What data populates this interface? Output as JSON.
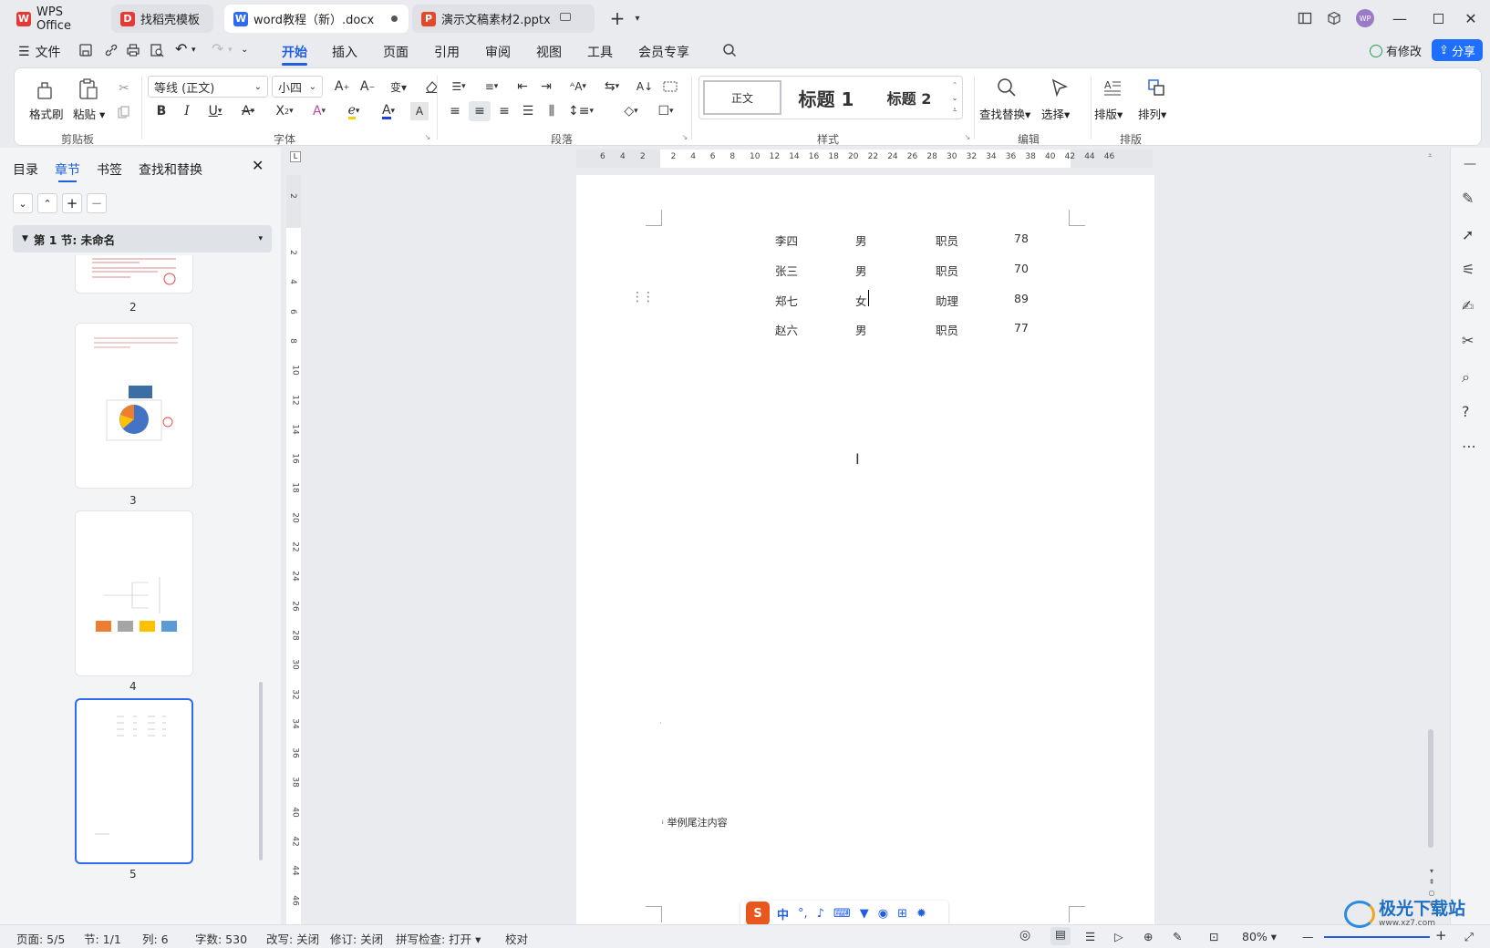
{
  "tabs": [
    {
      "label": "WPS Office",
      "icon": "wps-logo-icon",
      "color": "#e53935"
    },
    {
      "label": "找稻壳模板",
      "icon": "docer-icon",
      "color": "#e53935"
    },
    {
      "label": "word教程（新）.docx",
      "icon": "word-doc-icon",
      "color": "#2f6bf0"
    },
    {
      "label": "演示文稿素材2.pptx",
      "icon": "ppt-icon",
      "color": "#e0492a"
    }
  ],
  "user_avatar": "WP",
  "menu": {
    "file": "文件",
    "tabs": [
      "开始",
      "插入",
      "页面",
      "引用",
      "审阅",
      "视图",
      "工具",
      "会员专享"
    ],
    "active_tab": "开始",
    "modified": "有修改",
    "share": "分享"
  },
  "ribbon": {
    "format_painter": "格式刷",
    "paste": "粘贴",
    "clipboard_group": "剪贴板",
    "font_name": "等线 (正文)",
    "font_size": "小四",
    "font_group": "字体",
    "paragraph_group": "段落",
    "styles": {
      "normal": "正文",
      "h1": "标题 1",
      "h2": "标题 2"
    },
    "styles_group": "样式",
    "find_replace": "查找替换",
    "select": "选择",
    "edit_group": "编辑",
    "layout": "排版",
    "arrange": "排列",
    "layout_group": "排版"
  },
  "nav_panel": {
    "tabs": [
      "目录",
      "章节",
      "书签",
      "查找和替换"
    ],
    "active_tab": "章节",
    "section_title": "第 1 节: 未命名",
    "pages": [
      "2",
      "3",
      "4",
      "5"
    ],
    "selected_page": "5"
  },
  "ruler": {
    "h_ticks": [
      "6",
      "4",
      "2",
      "2",
      "4",
      "6",
      "8",
      "10",
      "12",
      "14",
      "16",
      "18",
      "20",
      "22",
      "24",
      "26",
      "28",
      "30",
      "32",
      "34",
      "36",
      "38",
      "40",
      "42",
      "44",
      "46"
    ],
    "v_ticks": [
      "2",
      "2",
      "4",
      "6",
      "8",
      "10",
      "12",
      "14",
      "16",
      "18",
      "20",
      "22",
      "24",
      "26",
      "28",
      "30",
      "32",
      "34",
      "36",
      "38",
      "40",
      "42",
      "44",
      "46"
    ]
  },
  "document": {
    "rows": [
      [
        "李四",
        "男",
        "职员",
        "78"
      ],
      [
        "张三",
        "男",
        "职员",
        "70"
      ],
      [
        "郑七",
        "女",
        "助理",
        "89"
      ],
      [
        "赵六",
        "男",
        "职员",
        "77"
      ]
    ],
    "endnote_mark": "i",
    "endnote_text": "举例尾注内容"
  },
  "ime_bar": {
    "mode": "中"
  },
  "status": {
    "page": "页面: 5/5",
    "section": "节: 1/1",
    "column": "列: 6",
    "word_count": "字数: 530",
    "rewrite": "改写: 关闭",
    "revision": "修订: 关闭",
    "spellcheck": "拼写检查: 打开",
    "proofread": "校对",
    "zoom": "80%"
  },
  "watermark": "极光下载站",
  "watermark_url": "www.xz7.com"
}
